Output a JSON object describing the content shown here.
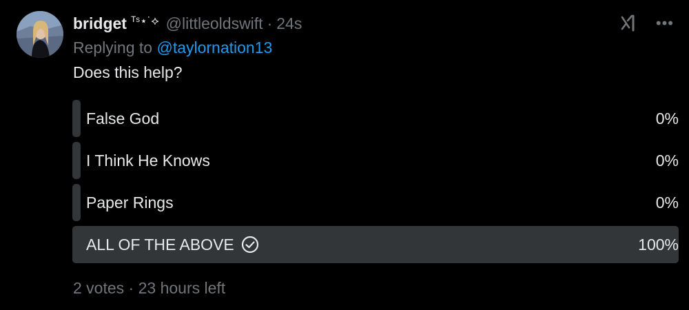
{
  "tweet": {
    "display_name": "bridget",
    "name_decoration": "ᵀˢ⋆˙⟡",
    "handle": "@littleoldswift",
    "separator": "·",
    "timestamp": "24s",
    "replying_prefix": "Replying to ",
    "replying_mention": "@taylornation13",
    "text": "Does this help?"
  },
  "poll": {
    "options": [
      {
        "label": "False God",
        "percent_text": "0%",
        "fraction": 0.0
      },
      {
        "label": "I Think He Knows",
        "percent_text": "0%",
        "fraction": 0.0
      },
      {
        "label": "Paper Rings",
        "percent_text": "0%",
        "fraction": 0.0
      },
      {
        "label": "ALL OF THE ABOVE",
        "percent_text": "100%",
        "fraction": 1.0,
        "selected": true
      }
    ],
    "votes": "2 votes",
    "footer_separator": "·",
    "time_left": "23 hours left"
  },
  "icons": {
    "grok": "grok-icon",
    "more": "more-options-icon",
    "check": "check-circle-icon"
  },
  "colors": {
    "background": "#000000",
    "primary_text": "#e7e9ea",
    "secondary_text": "#71767b",
    "mention": "#1d9bf0",
    "poll_fill": "#333639"
  }
}
